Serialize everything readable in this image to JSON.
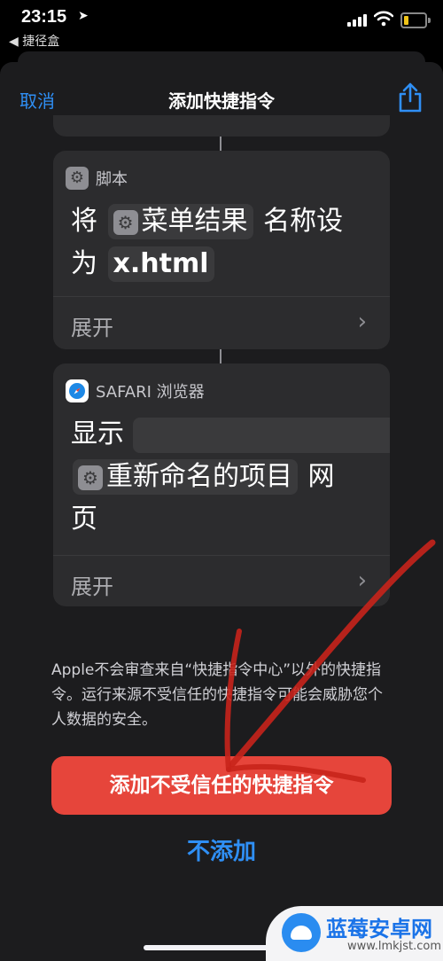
{
  "status_bar": {
    "time": "23:15",
    "back_app": "◀ 捷径盒"
  },
  "nav": {
    "cancel_label": "取消",
    "title": "添加快捷指令"
  },
  "script_card": {
    "category": "脚本",
    "text_prefix": "将",
    "var_token": "菜单结果",
    "text_mid": "名称设",
    "text_second_line_prefix": "为",
    "value_token": "x.html",
    "expand_label": "展开"
  },
  "safari_card": {
    "category": "SAFARI 浏览器",
    "text_prefix": "显示",
    "var_token": "重新命名的项目",
    "text_suffix": "网",
    "text_last": "页",
    "expand_label": "展开"
  },
  "warning_text": "Apple不会审查来自“快捷指令中心”以外的快捷指令。运行来源不受信任的快捷指令可能会威胁您个人数据的安全。",
  "add_button_label": "添加不受信任的快捷指令",
  "dont_add_label": "不添加",
  "watermark": {
    "title": "蓝莓安卓网",
    "url": "www.lmkjst.com"
  },
  "colors": {
    "accent": "#2f8ff5",
    "danger": "#e6453b",
    "annotation_arrow": "#c8231b"
  }
}
